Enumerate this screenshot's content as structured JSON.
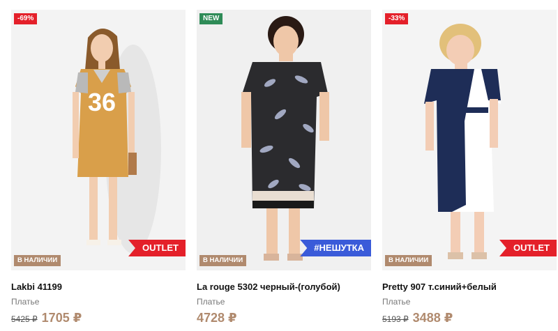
{
  "products": [
    {
      "badge": "-69%",
      "stock": "В НАЛИЧИИ",
      "ribbon": "OUTLET",
      "title": "Lakbi 41199",
      "subtitle": "Платье",
      "old_price": "5425 ₽",
      "price": "1705 ₽",
      "jersey_number": "36"
    },
    {
      "badge": "NEW",
      "stock": "В НАЛИЧИИ",
      "ribbon": "#НЕШУТКА",
      "title": "La rouge 5302 черный-(голубой)",
      "subtitle": "Платье",
      "old_price": "",
      "price": "4728 ₽"
    },
    {
      "badge": "-33%",
      "stock": "В НАЛИЧИИ",
      "ribbon": "OUTLET",
      "title": "Pretty 907 т.синий+белый",
      "subtitle": "Платье",
      "old_price": "5193 ₽",
      "price": "3488 ₽"
    }
  ],
  "colors": {
    "discount": "#e4202a",
    "new": "#2e8b57",
    "stock": "#b08a6e",
    "price": "#b08a6e",
    "tag_ribbon": "#3a5bd9"
  }
}
